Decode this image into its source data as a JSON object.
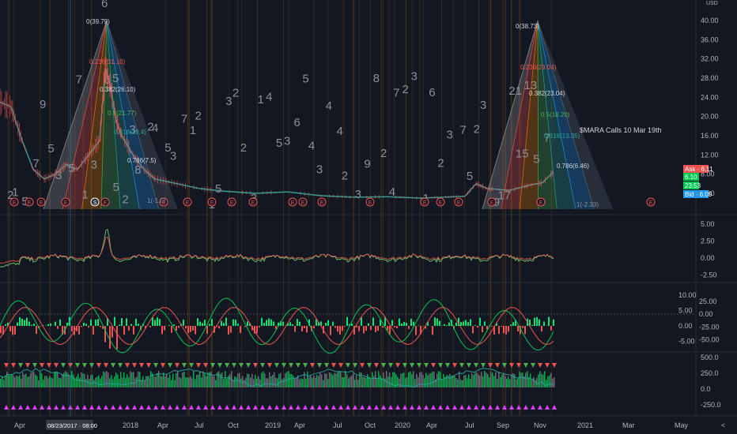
{
  "currency_label": "USD",
  "colors": {
    "background": "#131722",
    "up": "#26a69a",
    "green_bright": "#00e676",
    "down": "#ef5350",
    "ask": "#ef5350",
    "bid": "#2196f3",
    "fib_text": "#d1d4dc",
    "divider": "#2a2e39"
  },
  "chart_data": [
    {
      "type": "line",
      "panel": "price",
      "y_axis_ticks": [
        "40.00",
        "36.00",
        "32.00",
        "28.00",
        "24.00",
        "20.00",
        "16.00",
        "12.00",
        "8.00",
        "4.00"
      ],
      "ylim": [
        0,
        42
      ],
      "x_axis_ticks": [
        "Apr",
        "Jul",
        "Oct",
        "2018",
        "Apr",
        "Jul",
        "Oct",
        "2019",
        "Apr",
        "Jul",
        "Oct",
        "2020",
        "Apr",
        "Jul",
        "Sep",
        "Nov",
        "2021",
        "Mar",
        "May"
      ],
      "price_series": [
        {
          "t": 0,
          "v": 23
        },
        {
          "t": 2,
          "v": 22
        },
        {
          "t": 4,
          "v": 15
        },
        {
          "t": 6,
          "v": 9
        },
        {
          "t": 8,
          "v": 7
        },
        {
          "t": 10,
          "v": 8
        },
        {
          "t": 12,
          "v": 10
        },
        {
          "t": 14,
          "v": 9
        },
        {
          "t": 16,
          "v": 12
        },
        {
          "t": 18,
          "v": 15
        },
        {
          "t": 19,
          "v": 30
        },
        {
          "t": 20,
          "v": 26
        },
        {
          "t": 21,
          "v": 19
        },
        {
          "t": 22,
          "v": 16
        },
        {
          "t": 24,
          "v": 12
        },
        {
          "t": 26,
          "v": 9
        },
        {
          "t": 28,
          "v": 7
        },
        {
          "t": 32,
          "v": 6
        },
        {
          "t": 36,
          "v": 5
        },
        {
          "t": 40,
          "v": 4.5
        },
        {
          "t": 46,
          "v": 4
        },
        {
          "t": 52,
          "v": 4.3
        },
        {
          "t": 58,
          "v": 3.5
        },
        {
          "t": 64,
          "v": 3.2
        },
        {
          "t": 70,
          "v": 3.3
        },
        {
          "t": 76,
          "v": 3
        },
        {
          "t": 80,
          "v": 3.2
        },
        {
          "t": 84,
          "v": 3.4
        },
        {
          "t": 86,
          "v": 6
        },
        {
          "t": 88,
          "v": 5
        },
        {
          "t": 90,
          "v": 4.8
        },
        {
          "t": 92,
          "v": 4.6
        },
        {
          "t": 94,
          "v": 5.2
        },
        {
          "t": 96,
          "v": 5.8
        },
        {
          "t": 98,
          "v": 6.2
        },
        {
          "t": 100,
          "v": 8.5
        }
      ],
      "fib_labels_left": [
        "0(39.79)",
        "0.236(31.10)",
        "0.382(26.10)",
        "0.5(21.77)",
        "0.618(18.4)",
        "0.786(7.5)",
        "1(-1.0)"
      ],
      "fib_labels_right": [
        "0(38.73)",
        "0.236(29.04)",
        "0.382(23.04)",
        "0.5(18.20)",
        "0.618(13.35)",
        "0.786(6.46)",
        "1(-2.33)"
      ],
      "annotation": "$MARA Calls 10 Mar 19th",
      "price_tags": [
        {
          "label": "Ask · 6.11",
          "kind": "ask"
        },
        {
          "label": "6.10",
          "kind": "last"
        },
        {
          "label": "23:53",
          "kind": "time"
        },
        {
          "label": "Bid · 6.09",
          "kind": "bid"
        }
      ],
      "elliott_labels": [
        "2",
        "1",
        "5",
        "7",
        "9",
        "5",
        "3",
        "5",
        "7",
        "1",
        "3",
        "6",
        "5",
        "2",
        "3",
        "8",
        "2",
        "4",
        "5",
        "3",
        "7",
        "1",
        "2",
        "1",
        "5",
        "3",
        "2",
        "2",
        "3",
        "1",
        "4",
        "5",
        "3",
        "6",
        "5",
        "4",
        "3",
        "4",
        "4",
        "2",
        "3",
        "9",
        "8",
        "2",
        "4",
        "7",
        "2",
        "3",
        "1",
        "6",
        "2",
        "3",
        "7",
        "5",
        "2",
        "3",
        "9",
        "17",
        "21",
        "15",
        "13",
        "5",
        "7"
      ],
      "earnings_marker": "E",
      "dividend_marker": "S"
    },
    {
      "type": "line",
      "panel": "indicator_1",
      "y_axis_ticks": [
        "5.00",
        "2.50",
        "0.00",
        "-2.50"
      ],
      "ylim": [
        -3,
        6.5
      ]
    },
    {
      "type": "line",
      "panel": "indicator_2",
      "y_axis_ticks_left": [
        "10.00",
        "5.00",
        "0.00",
        "-5.00"
      ],
      "y_axis_ticks_right": [
        "25.00",
        "0.00",
        "-25.00",
        "-50.00"
      ],
      "ylim": [
        -7,
        12
      ]
    },
    {
      "type": "line",
      "panel": "indicator_3",
      "y_axis_ticks": [
        "500.0",
        "250.0",
        "0.0",
        "-250.0"
      ],
      "ylim": [
        -330,
        560
      ]
    }
  ],
  "time_cursor_label": "08/23/2017 · 08:00",
  "toolbar_glyph": "<",
  "wave_label_top_left": "6",
  "wave_label_mid": "5"
}
